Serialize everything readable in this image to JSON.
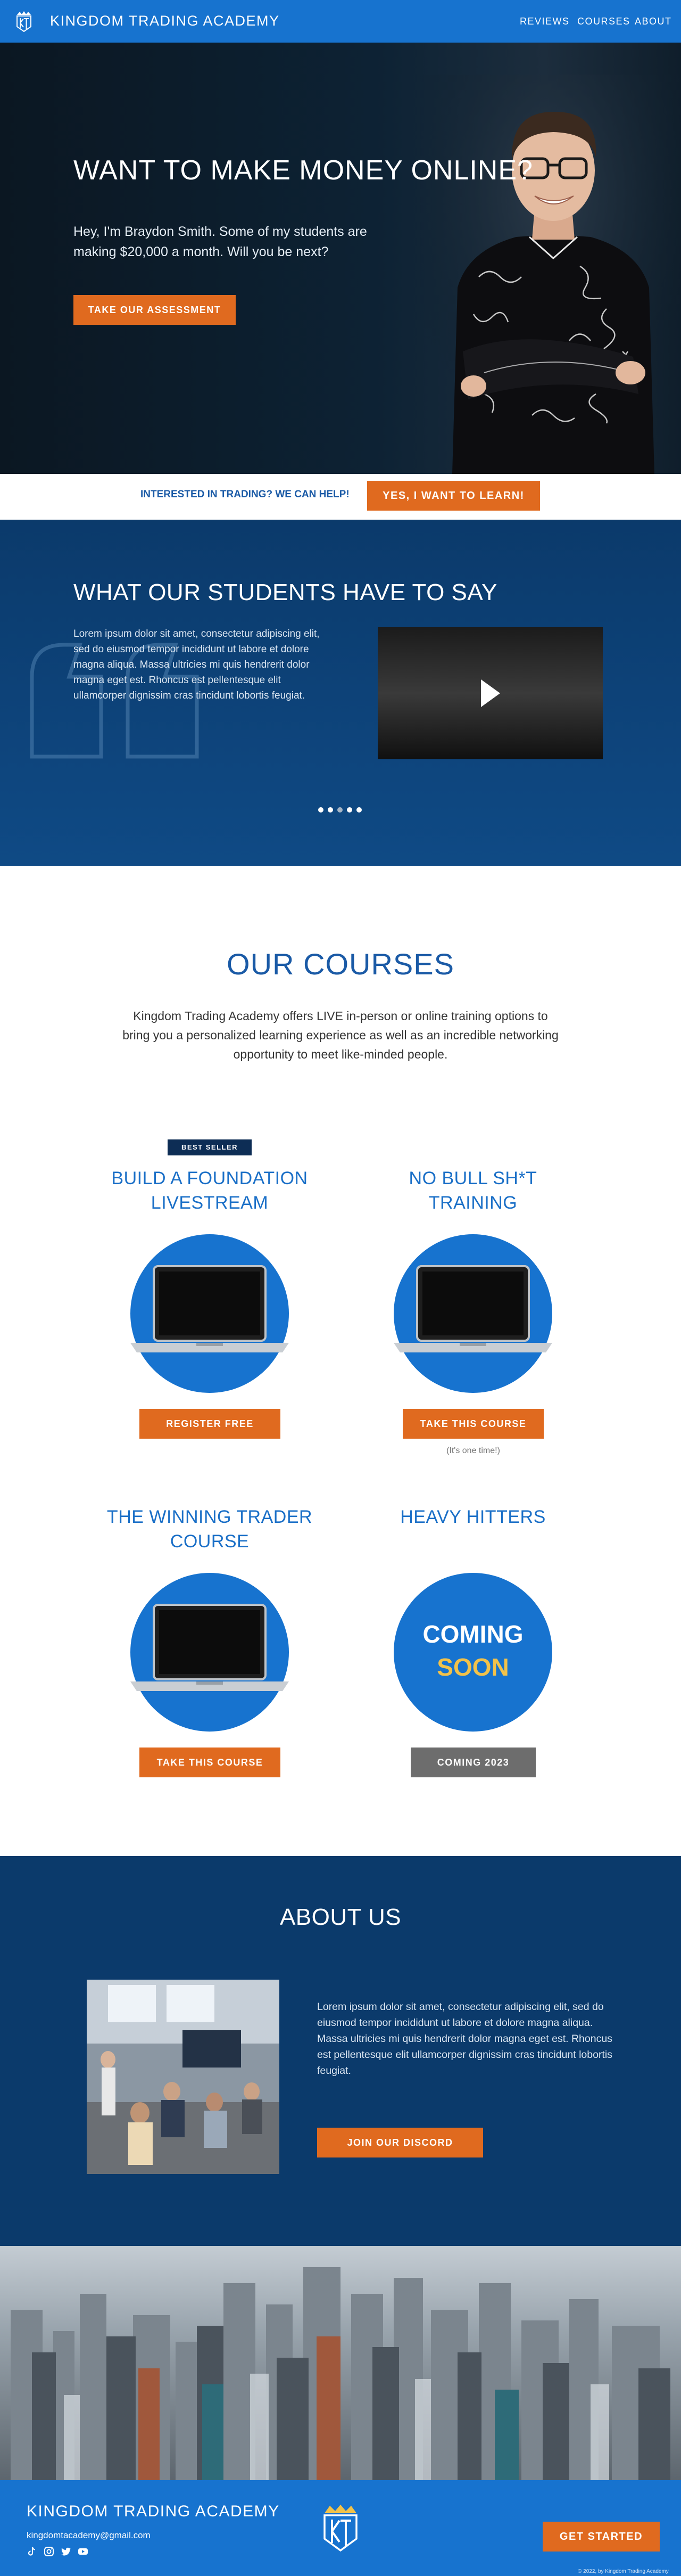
{
  "nav": {
    "brand": "KINGDOM TRADING ACADEMY",
    "links": [
      "REVIEWS",
      "COURSES",
      "ABOUT"
    ]
  },
  "hero": {
    "title": "WANT TO MAKE MONEY ONLINE?",
    "subtitle": "Hey, I'm Braydon Smith. Some of my students are making $20,000 a month. Will you be next?",
    "cta": "TAKE OUR ASSESSMENT"
  },
  "band": {
    "question": "INTERESTED IN TRADING? WE CAN HELP!",
    "cta": "YES, I WANT TO LEARN!"
  },
  "testimonials": {
    "title": "WHAT OUR STUDENTS HAVE TO SAY",
    "body": "Lorem ipsum dolor sit amet, consectetur adipiscing elit, sed do eiusmod tempor incididunt ut labore et dolore magna aliqua. Massa ultricies mi quis hendrerit dolor magna eget est. Rhoncus est pellentesque elit ullamcorper dignissim cras tincidunt lobortis feugiat.",
    "slide_count": 5,
    "active_slide": 2
  },
  "courses": {
    "title": "OUR COURSES",
    "intro": "Kingdom Trading Academy offers LIVE in-person or online training options to bring you a personalized learning experience as well as an incredible networking opportunity to meet like-minded people.",
    "items": [
      {
        "badge": "BEST SELLER",
        "title": "BUILD A FOUNDATION LIVESTREAM",
        "button": "REGISTER FREE",
        "note": ""
      },
      {
        "badge": "",
        "title": "NO BULL SH*T TRAINING",
        "button": "TAKE THIS COURSE",
        "note": "(It's one time!)"
      },
      {
        "badge": "",
        "title": "THE WINNING TRADER COURSE",
        "button": "TAKE THIS COURSE",
        "note": ""
      },
      {
        "badge": "",
        "title": "HEAVY HITTERS",
        "button": "COMING 2023",
        "note": "",
        "coming_top": "COMING",
        "coming_bottom": "SOON"
      }
    ]
  },
  "about": {
    "title": "ABOUT US",
    "body": "Lorem ipsum dolor sit amet, consectetur adipiscing elit, sed do eiusmod tempor incididunt ut labore et dolore magna aliqua. Massa ultricies mi quis hendrerit dolor magna eget est. Rhoncus est pellentesque elit ullamcorper dignissim cras tincidunt lobortis feugiat.",
    "cta": "JOIN OUR DISCORD"
  },
  "footer": {
    "brand": "KINGDOM TRADING ACADEMY",
    "email": "kingdomtacademy@gmail.com",
    "social_icons": [
      "tiktok-icon",
      "instagram-icon",
      "twitter-icon",
      "youtube-icon"
    ],
    "cta": "GET STARTED",
    "copyright": "© 2022, by Kingdom Trading Academy"
  },
  "colors": {
    "primary_blue": "#1773cf",
    "navy": "#0b3a6b",
    "orange": "#e06a1f",
    "grey_button": "#6d6d6d",
    "soon_yellow": "#f2c24a"
  }
}
